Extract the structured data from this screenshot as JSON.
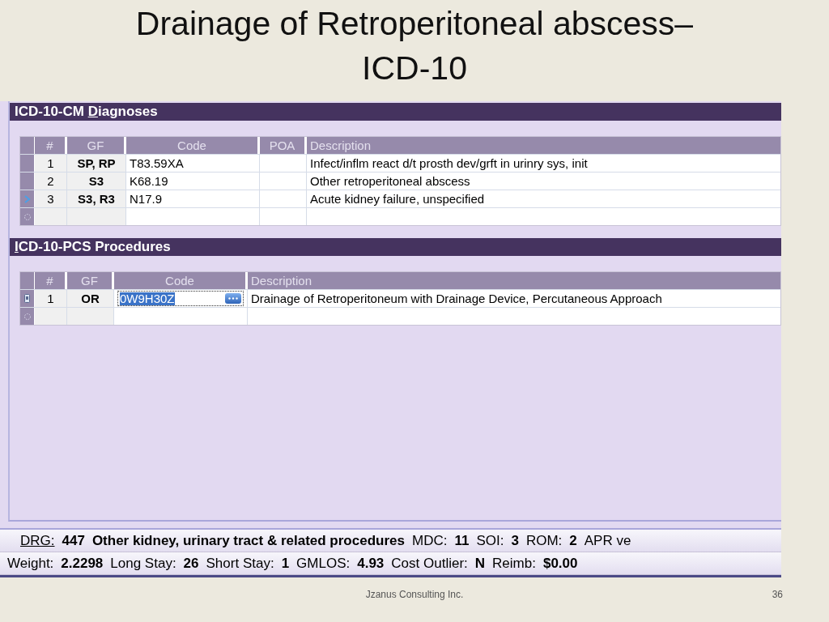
{
  "slide": {
    "title_lines": [
      "Drainage of Retroperitoneal abscess–",
      "ICD-10"
    ],
    "footer": "Jzanus Consulting Inc.",
    "page_number": "36"
  },
  "diagnoses": {
    "title_before": "ICD-10-CM ",
    "title_mnemonic": "D",
    "title_after": "iagnoses",
    "columns": [
      "#",
      "GF",
      "Code",
      "POA",
      "Description"
    ],
    "rows": [
      {
        "num": "1",
        "gf": "SP, RP",
        "code": "T83.59XA",
        "description": "Infect/inflm react d/t prosth dev/grft in urinry sys, init",
        "current": false
      },
      {
        "num": "2",
        "gf": "S3",
        "code": "K68.19",
        "description": "Other retroperitoneal abscess",
        "current": false
      },
      {
        "num": "3",
        "gf": "S3, R3",
        "code": "N17.9",
        "description": "Acute kidney failure, unspecified",
        "current": true
      }
    ]
  },
  "procedures": {
    "title_mnemonic": "I",
    "title_after": "CD-10-PCS Procedures",
    "columns": [
      "#",
      "GF",
      "Code",
      "Description"
    ],
    "rows": [
      {
        "num": "1",
        "gf": "OR",
        "code": "0W9H30Z",
        "description": "Drainage of Retroperitoneum with Drainage Device, Percutaneous Approach",
        "editing": true
      }
    ]
  },
  "drg_line": [
    {
      "label": "DRG:",
      "value": "447"
    },
    {
      "value": "Other kidney, urinary tract & related procedures"
    },
    {
      "label": "MDC:",
      "value": "11"
    },
    {
      "label": "SOI:",
      "value": "3"
    },
    {
      "label": "ROM:",
      "value": "2"
    },
    {
      "label": "APR ve"
    }
  ],
  "stats_line": [
    {
      "label": "Weight:",
      "value": "2.2298"
    },
    {
      "label": "Long Stay:",
      "value": "26"
    },
    {
      "label": "Short Stay:",
      "value": "1"
    },
    {
      "label": "GMLOS:",
      "value": "4.93"
    },
    {
      "label": "Cost Outlier:",
      "value": "N"
    },
    {
      "label": "Reimb:",
      "value": "$0.00"
    }
  ]
}
